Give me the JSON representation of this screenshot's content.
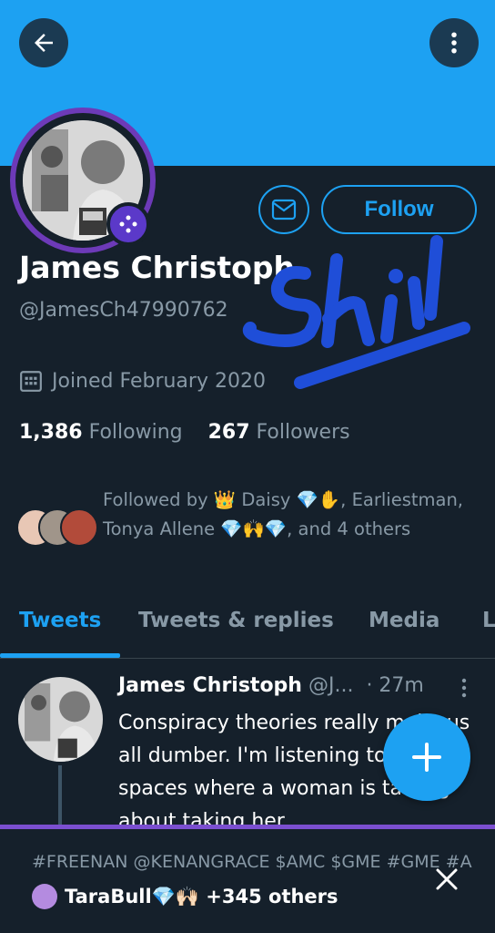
{
  "header": {
    "back_icon": "arrow-left-icon",
    "more_icon": "more-vertical-icon",
    "banner_color": "#1da1f2"
  },
  "profile": {
    "name": "James Christoph",
    "handle": "@JamesCh47990762",
    "follow_label": "Follow",
    "message_icon": "mail-icon",
    "badge_icon": "spaces-badge-icon",
    "joined": "Joined February 2020",
    "following_count": "1,386",
    "following_label": "Following",
    "followers_count": "267",
    "followers_label": "Followers",
    "followed_by": "Followed by 👑 Daisy 💎✋, Earliestman, Tonya Allene 💎🙌💎, and 4 others",
    "annotation_text": "Shill",
    "annotation_color": "#1f4ed8"
  },
  "tabs": [
    {
      "label": "Tweets",
      "active": true
    },
    {
      "label": "Tweets & replies",
      "active": false
    },
    {
      "label": "Media",
      "active": false
    },
    {
      "label": "L",
      "active": false
    }
  ],
  "tweet": {
    "author": "James Christoph",
    "handle": "@J...",
    "time": "· 27m",
    "text": "Conspiracy theories really make us all dumber. I'm listening to an AMC spaces where a woman is talking about taking her"
  },
  "fab": {
    "icon": "plus-icon"
  },
  "spaces": {
    "tags": "#FREENAN @KENANGRACE $AMC $GME #GME #A",
    "host": "TaraBull💎🙌🏻 +345 others",
    "close_icon": "close-icon",
    "accent": "#7b4fd0"
  }
}
